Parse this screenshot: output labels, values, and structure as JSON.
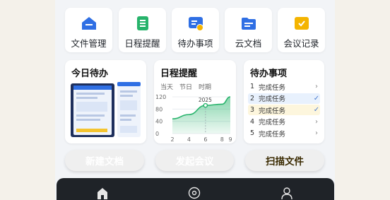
{
  "tiles": [
    {
      "label": "文件管理",
      "icon": "folder-home-icon",
      "color": "#2f6fe4"
    },
    {
      "label": "日程提醒",
      "icon": "document-list-icon",
      "color": "#27b36b"
    },
    {
      "label": "待办事项",
      "icon": "todo-clock-icon",
      "color": "#2f6fe4"
    },
    {
      "label": "云文档",
      "icon": "cloud-folder-icon",
      "color": "#2f6fe4"
    },
    {
      "label": "会议记录",
      "icon": "check-note-icon",
      "color": "#f4b400"
    }
  ],
  "today_card": {
    "title": "今日待办"
  },
  "schedule_card": {
    "title": "日程提醒",
    "filters": [
      "当天",
      "节日",
      "时期"
    ],
    "chart_data": {
      "type": "area",
      "x": [
        2,
        4,
        6,
        8,
        9
      ],
      "y_ticks": [
        120,
        80,
        40,
        0
      ],
      "x_ticks": [
        "2",
        "4",
        "6",
        "8",
        "9"
      ],
      "series": [
        {
          "values": [
            48,
            62,
            92,
            96,
            120
          ]
        }
      ],
      "ylim": [
        0,
        120
      ],
      "highlight": {
        "x": 6,
        "value": 92,
        "label": "2025"
      },
      "color": "#27b36b"
    }
  },
  "todo_card": {
    "title": "待办事项",
    "items": [
      {
        "num": "1",
        "text": "完成任务",
        "mark": "chevron-right",
        "mark_glyph": "›",
        "bg": "#ffffff"
      },
      {
        "num": "2",
        "text": "完成任务",
        "mark": "check",
        "mark_glyph": "✓",
        "bg": "#e8f1fd"
      },
      {
        "num": "3",
        "text": "完成任务",
        "mark": "check",
        "mark_glyph": "✓",
        "bg": "#fdf6dd"
      },
      {
        "num": "4",
        "text": "完成任务",
        "mark": "chevron-right",
        "mark_glyph": "›",
        "bg": "#ffffff"
      },
      {
        "num": "5",
        "text": "完成任务",
        "mark": "chevron-right",
        "mark_glyph": "›",
        "bg": "#ffffff"
      }
    ]
  },
  "buttons": [
    {
      "label": "新建文档",
      "color": "#2f6fe4"
    },
    {
      "label": "发起会议",
      "color": "#2f6fe4"
    },
    {
      "label": "扫描文件",
      "color": "#f4c430"
    }
  ],
  "nav": {
    "items": [
      "home-icon",
      "discover-icon",
      "profile-icon"
    ]
  }
}
